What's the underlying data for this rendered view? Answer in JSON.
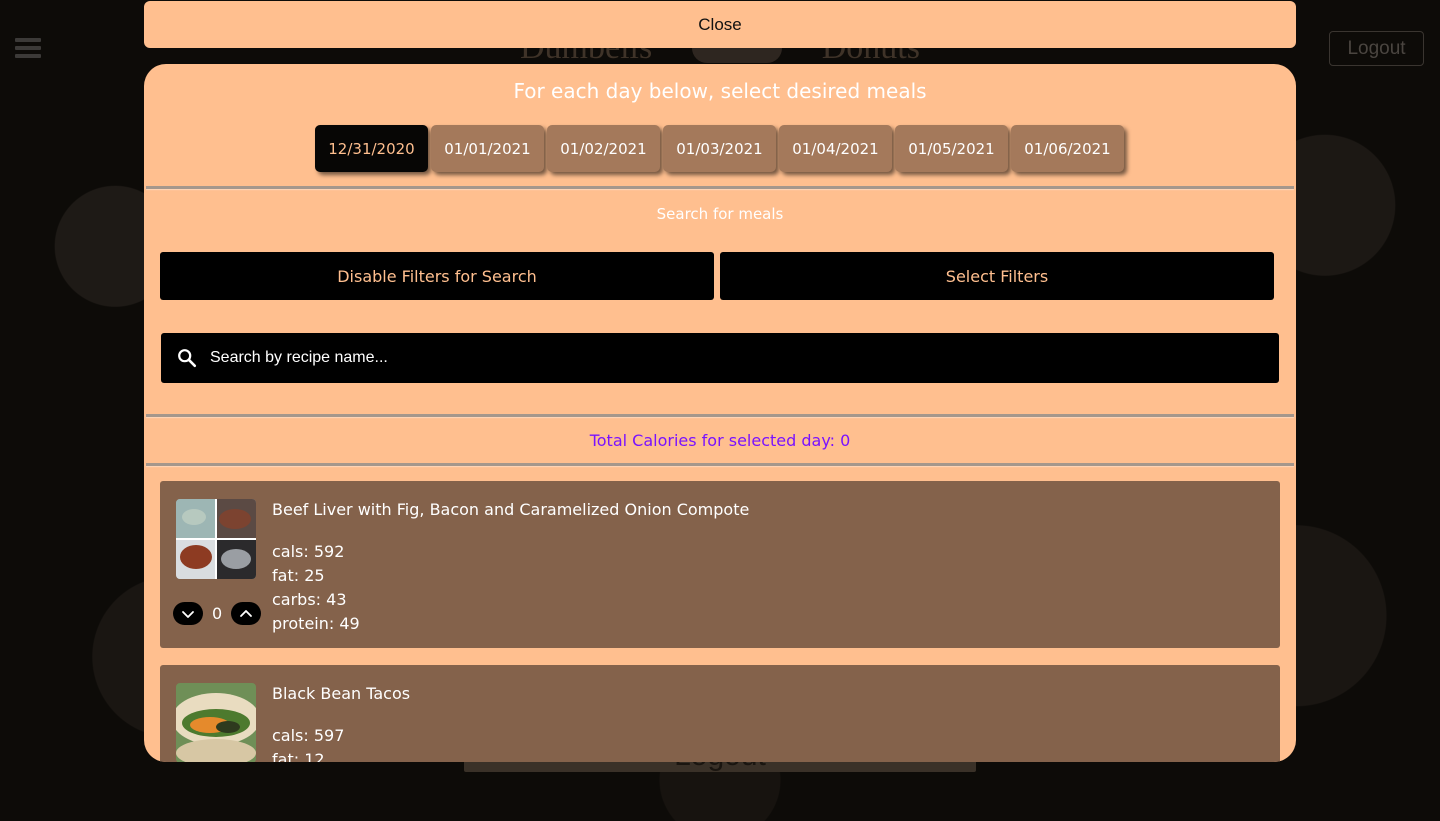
{
  "background": {
    "title_left": "Dumbells",
    "title_right": "Donuts",
    "logout_label": "Logout",
    "logout_large_label": "Logout"
  },
  "overlay": {
    "close_label": "Close",
    "heading": "For each day below, select desired meals",
    "dates": [
      "12/31/2020",
      "01/01/2021",
      "01/02/2021",
      "01/03/2021",
      "01/04/2021",
      "01/05/2021",
      "01/06/2021"
    ],
    "active_date": "12/31/2020",
    "search_heading": "Search for meals",
    "disable_filters_label": "Disable Filters for Search",
    "select_filters_label": "Select Filters",
    "search_placeholder": "Search by recipe name...",
    "calories_label": "Total Calories for selected day: 0"
  },
  "meals": [
    {
      "name": "Beef Liver with Fig, Bacon and Caramelized Onion Compote",
      "cals": "cals: 592",
      "fat": "fat: 25",
      "carbs": "carbs: 43",
      "protein": "protein: 49",
      "quantity": "0"
    },
    {
      "name": "Black Bean Tacos",
      "cals": "cals: 597",
      "fat": "fat: 12"
    }
  ],
  "colors": {
    "accent": "#ffbf8f",
    "card": "#84624b",
    "tab": "#a4795b",
    "calories_text": "#7a12ff"
  },
  "icons": [
    "menu-icon",
    "search-icon",
    "chevron-down-icon",
    "chevron-up-icon"
  ]
}
